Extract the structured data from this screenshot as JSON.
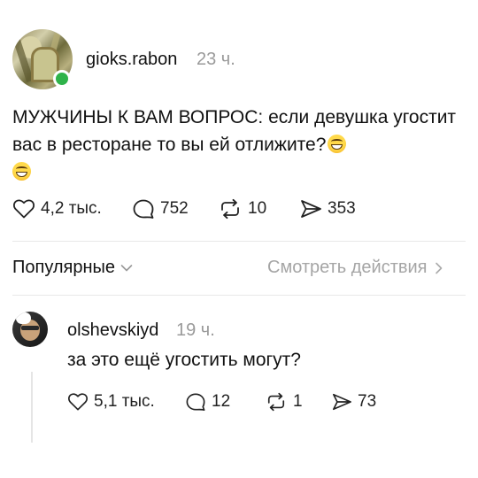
{
  "post": {
    "username": "gioks.rabon",
    "time": "23 ч.",
    "text": "МУЖЧИНЫ К ВАМ ВОПРОС: если девушка угостит вас в ресторане то вы ей отлижите?",
    "emoji_names": [
      "grinning-face-emoji",
      "grinning-face-emoji"
    ],
    "actions": {
      "likes": "4,2 тыс.",
      "comments": "752",
      "reposts": "10",
      "shares": "353"
    },
    "status_color": "#2fb34a"
  },
  "sort": {
    "label": "Популярные",
    "view_actions": "Смотреть действия"
  },
  "reply": {
    "username": "olshevskiyd",
    "time": "19 ч.",
    "text": "за это ещё угостить могут?",
    "actions": {
      "likes": "5,1 тыс.",
      "comments": "12",
      "reposts": "1",
      "shares": "73"
    }
  },
  "icons": [
    "heart-icon",
    "comment-icon",
    "repost-icon",
    "share-icon",
    "chevron-down-icon",
    "chevron-right-icon"
  ]
}
